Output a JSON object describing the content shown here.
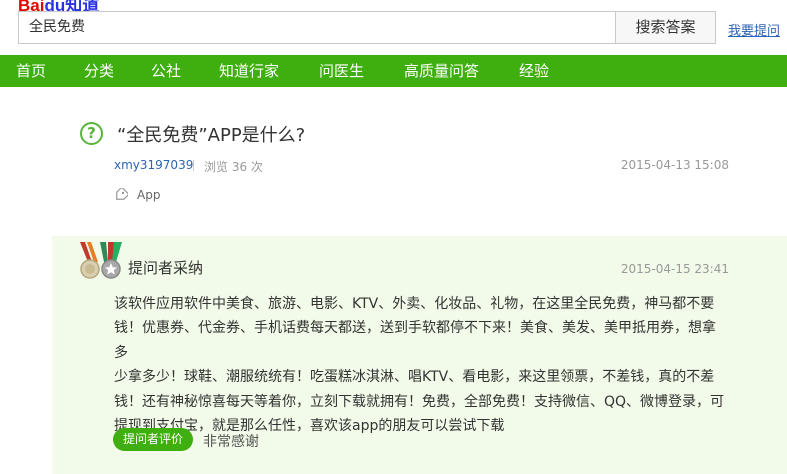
{
  "logo": {
    "part1": "Bai",
    "part2": "du知道"
  },
  "search": {
    "value": "全民免费",
    "button_label": "搜索答案",
    "ask_link": "我要提问"
  },
  "nav": {
    "items": [
      {
        "label": "首页"
      },
      {
        "label": "分类"
      },
      {
        "label": "公社"
      },
      {
        "label": "知道行家"
      },
      {
        "label": "问医生"
      },
      {
        "label": "高质量问答"
      },
      {
        "label": "经验"
      }
    ]
  },
  "question": {
    "icon_text": "?",
    "title": "“全民免费”APP是什么?",
    "asker": "xmy3197039",
    "views": "浏览 36 次",
    "time": "2015-04-13 15:08",
    "tag": "App"
  },
  "answer": {
    "adopted_label": "提问者采纳",
    "time": "2015-04-15 23:41",
    "lines": [
      "该软件应用软件中美食、旅游、电影、KTV、外卖、化妆品、礼物，在这里全民免费，神马都不要",
      "钱！优惠券、代金券、手机话费每天都送，送到手软都停不下来！美食、美发、美甲抵用券，想拿多",
      "少拿多少！球鞋、潮服统统有！吃蛋糕冰淇淋、唱KTV、看电影，来这里领票，不差钱，真的不差",
      "钱！还有神秘惊喜每天等着你，立刻下载就拥有！免费，全部免费！支持微信、QQ、微博登录，可",
      "提现到支付宝，就是那么任性，喜欢该app的朋友可以尝试下载"
    ],
    "eval_button": "提问者评价",
    "eval_text": "非常感谢"
  },
  "colors": {
    "brand_green": "#3eaf0e",
    "link_blue": "#2d64b3",
    "answer_bg": "#f2fbe9"
  }
}
